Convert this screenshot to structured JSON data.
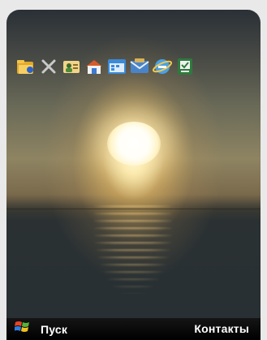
{
  "taskbar": {
    "start_label": "Пуск",
    "contacts_label": "Контакты"
  },
  "today_icons": [
    {
      "name": "folder-app-icon"
    },
    {
      "name": "close-x-icon"
    },
    {
      "name": "owner-info-icon"
    },
    {
      "name": "home-network-icon"
    },
    {
      "name": "calendar-icon"
    },
    {
      "name": "messages-icon"
    },
    {
      "name": "internet-explorer-icon"
    },
    {
      "name": "tasks-icon"
    }
  ],
  "colors": {
    "softbar_bg": "#000000",
    "softkey_text": "#ffffff"
  }
}
